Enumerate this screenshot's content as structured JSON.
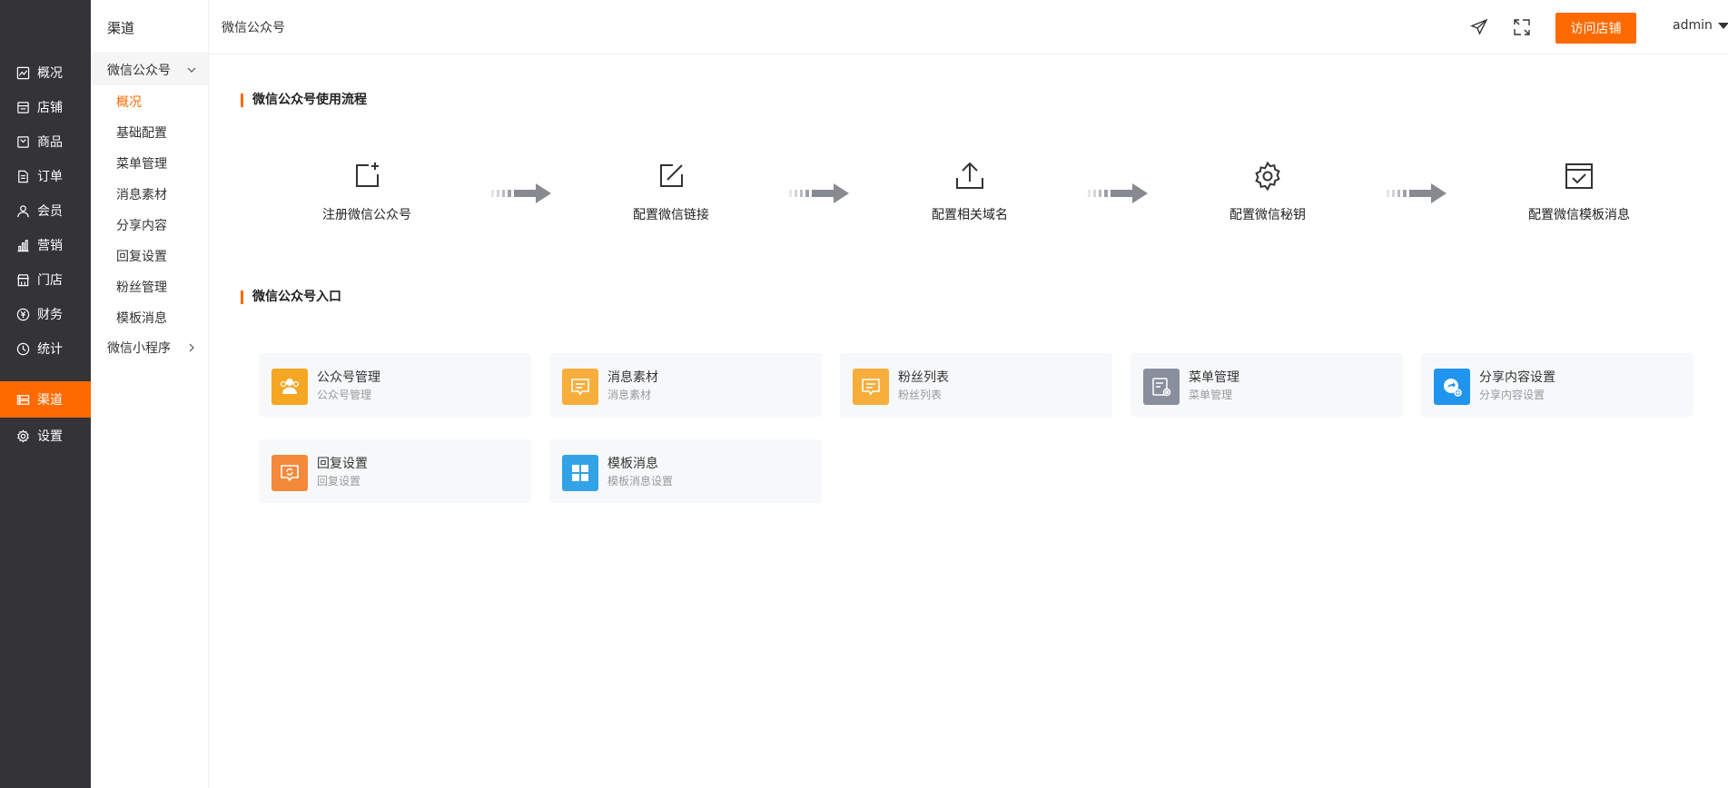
{
  "main_nav": {
    "items": [
      {
        "label": "概况",
        "icon": "chart-line-icon"
      },
      {
        "label": "店铺",
        "icon": "store-icon"
      },
      {
        "label": "商品",
        "icon": "goods-icon"
      },
      {
        "label": "订单",
        "icon": "order-icon"
      },
      {
        "label": "会员",
        "icon": "member-icon"
      },
      {
        "label": "营销",
        "icon": "marketing-icon"
      },
      {
        "label": "门店",
        "icon": "shop-icon"
      },
      {
        "label": "财务",
        "icon": "finance-icon"
      },
      {
        "label": "统计",
        "icon": "statistics-icon"
      },
      {
        "label": "渠道",
        "icon": "channel-icon"
      },
      {
        "label": "设置",
        "icon": "gear-icon"
      }
    ],
    "active_index": 9
  },
  "sub_nav": {
    "title": "渠道",
    "groups": [
      {
        "label": "微信公众号",
        "expanded": true
      },
      {
        "label": "微信小程序",
        "expanded": false
      }
    ],
    "items": [
      "概况",
      "基础配置",
      "菜单管理",
      "消息素材",
      "分享内容",
      "回复设置",
      "粉丝管理",
      "模板消息"
    ],
    "active_item": "概况"
  },
  "header": {
    "breadcrumb": "微信公众号",
    "visit_button": "访问店铺",
    "user": "admin"
  },
  "flow": {
    "title": "微信公众号使用流程",
    "steps": [
      {
        "label": "注册微信公众号",
        "icon": "add-square-icon"
      },
      {
        "label": "配置微信链接",
        "icon": "edit-icon"
      },
      {
        "label": "配置相关域名",
        "icon": "upload-icon"
      },
      {
        "label": "配置微信秘钥",
        "icon": "gear-icon"
      },
      {
        "label": "配置微信模板消息",
        "icon": "check-square-icon"
      }
    ]
  },
  "entries": {
    "title": "微信公众号入口",
    "cards": [
      {
        "title": "公众号管理",
        "subtitle": "公众号管理",
        "icon": "users-icon",
        "color": "#f5a623"
      },
      {
        "title": "消息素材",
        "subtitle": "消息素材",
        "icon": "message-icon",
        "color": "#f7ae3b"
      },
      {
        "title": "粉丝列表",
        "subtitle": "粉丝列表",
        "icon": "message-icon",
        "color": "#f7ae3b"
      },
      {
        "title": "菜单管理",
        "subtitle": "菜单管理",
        "icon": "menu-settings-icon",
        "color": "#8a8f9e"
      },
      {
        "title": "分享内容设置",
        "subtitle": "分享内容设置",
        "icon": "share-icon",
        "color": "#1f95f0"
      },
      {
        "title": "回复设置",
        "subtitle": "回复设置",
        "icon": "reply-icon",
        "color": "#f5893a"
      },
      {
        "title": "模板消息",
        "subtitle": "模板消息设置",
        "icon": "template-grid-icon",
        "color": "#33a3e8"
      }
    ]
  },
  "colors": {
    "accent": "#fe6a00",
    "sidebar_bg": "#333338"
  }
}
